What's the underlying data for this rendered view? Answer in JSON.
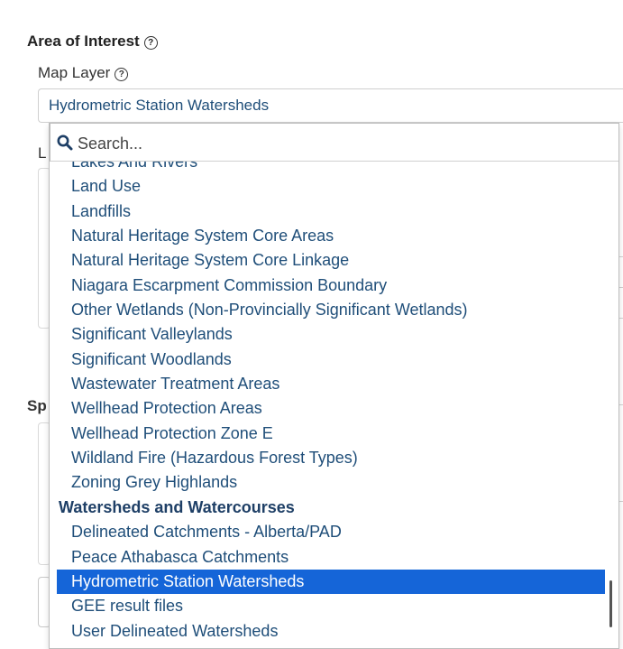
{
  "section": {
    "title": "Area of Interest",
    "help_icon": "?"
  },
  "map_layer": {
    "label": "Map Layer",
    "help_icon": "?",
    "selected_value": "Hydrometric Station Watersheds"
  },
  "background": {
    "frag_l": "L",
    "frag_sp": "Sp"
  },
  "dropdown": {
    "search_placeholder": "Search...",
    "items": [
      {
        "label": "Lakes And Rivers",
        "type": "option"
      },
      {
        "label": "Land Use",
        "type": "option"
      },
      {
        "label": "Landfills",
        "type": "option"
      },
      {
        "label": "Natural Heritage System Core Areas",
        "type": "option"
      },
      {
        "label": "Natural Heritage System Core Linkage",
        "type": "option"
      },
      {
        "label": "Niagara Escarpment Commission Boundary",
        "type": "option"
      },
      {
        "label": "Other Wetlands (Non-Provincially Significant Wetlands)",
        "type": "option"
      },
      {
        "label": "Significant Valleylands",
        "type": "option"
      },
      {
        "label": "Significant Woodlands",
        "type": "option"
      },
      {
        "label": "Wastewater Treatment Areas",
        "type": "option"
      },
      {
        "label": "Wellhead Protection Areas",
        "type": "option"
      },
      {
        "label": "Wellhead Protection Zone E",
        "type": "option"
      },
      {
        "label": "Wildland Fire (Hazardous Forest Types)",
        "type": "option"
      },
      {
        "label": "Zoning Grey Highlands",
        "type": "option"
      },
      {
        "label": "Watersheds and Watercourses",
        "type": "group"
      },
      {
        "label": "Delineated Catchments - Alberta/PAD",
        "type": "option"
      },
      {
        "label": "Peace Athabasca Catchments",
        "type": "option"
      },
      {
        "label": "Hydrometric Station Watersheds",
        "type": "option",
        "selected": true
      },
      {
        "label": "GEE result files",
        "type": "option"
      },
      {
        "label": "User Delineated Watersheds",
        "type": "option"
      }
    ]
  },
  "colors": {
    "selected_bg": "#1565d8",
    "option_text": "#1f4e79",
    "group_text": "#1e3f66"
  }
}
